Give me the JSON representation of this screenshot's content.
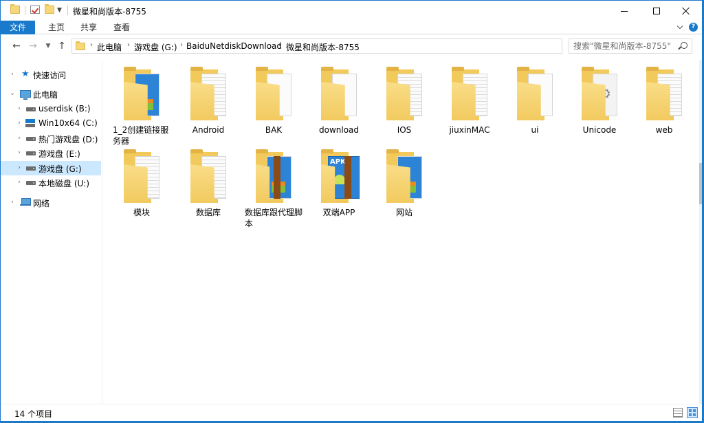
{
  "window": {
    "title": "微星和尚版本-8755"
  },
  "ribbon": {
    "tabs": [
      "文件",
      "主页",
      "共享",
      "查看"
    ]
  },
  "address": {
    "crumbs": [
      "此电脑",
      "游戏盘 (G:)",
      "BaiduNetdiskDownload",
      "微星和尚版本-8755"
    ]
  },
  "search": {
    "placeholder": "搜索\"微星和尚版本-8755\""
  },
  "sidebar": {
    "items": [
      {
        "label": "快速访问",
        "icon": "star-icon"
      },
      {
        "label": "此电脑",
        "icon": "pc-icon"
      },
      {
        "label": "userdisk (B:)",
        "icon": "drive-icon"
      },
      {
        "label": "Win10x64 (C:)",
        "icon": "windows-drive-icon"
      },
      {
        "label": "热门游戏盘 (D:)",
        "icon": "drive-icon"
      },
      {
        "label": "游戏盘 (E:)",
        "icon": "drive-icon"
      },
      {
        "label": "游戏盘 (G:)",
        "icon": "drive-icon",
        "selected": true
      },
      {
        "label": "本地磁盘 (U:)",
        "icon": "drive-icon"
      },
      {
        "label": "网络",
        "icon": "network-icon"
      }
    ]
  },
  "files": [
    {
      "name": "1_2创建链接服务器",
      "icon": "folder-with-media-icon"
    },
    {
      "name": "Android",
      "icon": "folder-with-document-icon"
    },
    {
      "name": "BAK",
      "icon": "folder-with-document-icon"
    },
    {
      "name": "download",
      "icon": "folder-with-document-icon"
    },
    {
      "name": "IOS",
      "icon": "folder-with-document-icon"
    },
    {
      "name": "jiuxinMAC",
      "icon": "folder-with-document-icon"
    },
    {
      "name": "ui",
      "icon": "folder-with-document-icon"
    },
    {
      "name": "Unicode",
      "icon": "folder-with-settings-icon"
    },
    {
      "name": "web",
      "icon": "folder-with-document-icon"
    },
    {
      "name": "模块",
      "icon": "folder-with-document-icon"
    },
    {
      "name": "数据库",
      "icon": "folder-with-document-icon"
    },
    {
      "name": "数据库跟代理脚本",
      "icon": "archive-folder-icon"
    },
    {
      "name": "双端APP",
      "icon": "apk-archive-folder-icon",
      "badge": "APK"
    },
    {
      "name": "网站",
      "icon": "folder-with-media-icon"
    }
  ],
  "status": {
    "item_count": "14 个项目"
  },
  "colors": {
    "accent": "#1979ca",
    "selection": "#cce8ff",
    "folder": "#f2c95b"
  }
}
